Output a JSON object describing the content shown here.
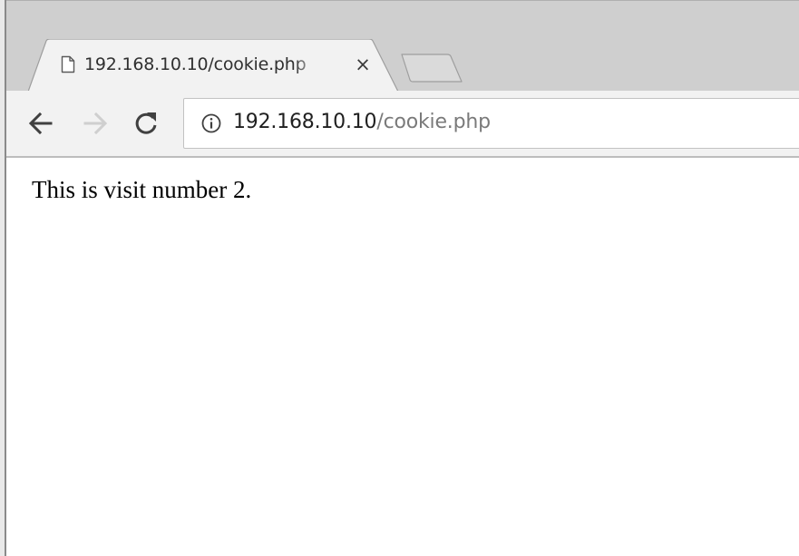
{
  "tab": {
    "title": "192.168.10.10/cookie.php",
    "favicon": "page-icon",
    "close_label": "×"
  },
  "toolbar": {
    "back_icon": "back-arrow-icon",
    "forward_icon": "forward-arrow-icon",
    "reload_icon": "reload-icon"
  },
  "omnibox": {
    "security_icon": "info-icon",
    "url_host": "192.168.10.10",
    "url_path": "/cookie.php"
  },
  "page": {
    "text": "This is visit number 2."
  },
  "colors": {
    "titlebar": "#cfcfcf",
    "toolbar": "#f2f2f2",
    "url_host": "#202020",
    "url_path": "#7a7a7a",
    "forward_disabled": "#cfcfcf"
  }
}
